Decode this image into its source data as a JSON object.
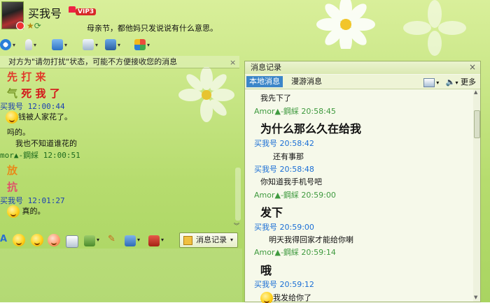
{
  "window": {
    "nickname": "买我号",
    "vip_badge": "VIP3",
    "signature": "母亲节，都他妈只发说说有什么意思。"
  },
  "notice": {
    "text": "对方为\"请勿打扰\"状态，可能不方便接收您的消息",
    "close": "×"
  },
  "chat": {
    "lines": [
      {
        "kind": "big",
        "text": "先 打 来",
        "color": "#e03a2a"
      },
      {
        "kind": "big",
        "text": "死 我 了",
        "color": "#d4161a"
      },
      {
        "kind": "sender",
        "text": "买我号  12:00:44"
      },
      {
        "kind": "msg",
        "text": "钱被人家花了。"
      },
      {
        "kind": "msg",
        "text": "吗的。"
      },
      {
        "kind": "msg",
        "text": "我也不知道谁花的"
      },
      {
        "kind": "sender2",
        "text": "mor▲-鋼綵  12:00:51"
      },
      {
        "kind": "big",
        "text": "放",
        "color": "#e88a1a"
      },
      {
        "kind": "big",
        "text": "抗",
        "color": "#e0506a"
      },
      {
        "kind": "sender",
        "text": "买我号  12:01:27"
      },
      {
        "kind": "msg",
        "text": "真的。"
      }
    ],
    "big_prefix_1": "气"
  },
  "toolbar": {
    "record_button": "消息记录"
  },
  "history": {
    "title": "消息记录",
    "close": "×",
    "tab_local": "本地消息",
    "tab_roam": "漫游消息",
    "more": "更多",
    "entries": [
      {
        "type": "msg",
        "text": "我先下了"
      },
      {
        "type": "sender2",
        "text": "Amor▲-鋼綵 20:58:45"
      },
      {
        "type": "big",
        "text": "为什么那么久在给我"
      },
      {
        "type": "sender",
        "text": "买我号 20:58:42"
      },
      {
        "type": "msg",
        "text": "还有事那"
      },
      {
        "type": "sender",
        "text": "买我号 20:58:48"
      },
      {
        "type": "msg",
        "text": "你知道我手机号吧"
      },
      {
        "type": "sender2",
        "text": "Amor▲-鋼綵 20:59:00"
      },
      {
        "type": "big",
        "text": "发下"
      },
      {
        "type": "sender",
        "text": "买我号 20:59:00"
      },
      {
        "type": "msg",
        "text": "明天我得回家才能给你喇"
      },
      {
        "type": "sender2",
        "text": "Amor▲-鋼綵 20:59:14"
      },
      {
        "type": "big",
        "text": "哦"
      },
      {
        "type": "sender",
        "text": "买我号 20:59:12"
      },
      {
        "type": "msg",
        "text": "我发给你了"
      }
    ]
  },
  "colors": {
    "accent_blue": "#3c86c9",
    "sender_blue": "#1b6fd6",
    "sender_green": "#3f9a3f"
  }
}
